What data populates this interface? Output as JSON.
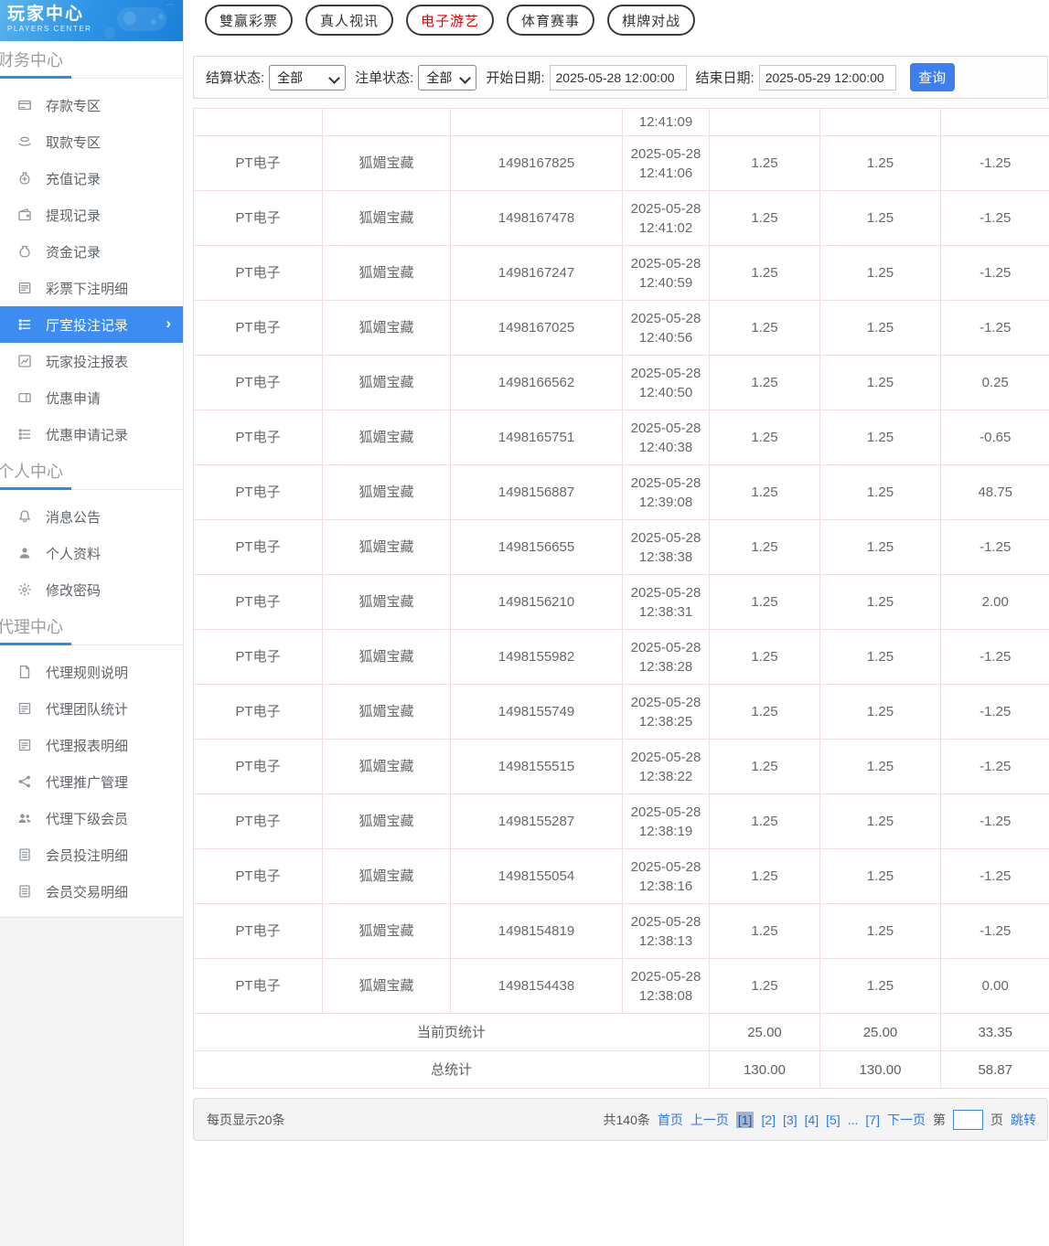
{
  "logo": {
    "title": "玩家中心",
    "subtitle": "PLAYERS CENTER"
  },
  "top_tabs": [
    {
      "label": "雙赢彩票",
      "active": false
    },
    {
      "label": "真人视讯",
      "active": false
    },
    {
      "label": "电子游艺",
      "active": true
    },
    {
      "label": "体育赛事",
      "active": false
    },
    {
      "label": "棋牌对战",
      "active": false
    }
  ],
  "sidebar": {
    "sections": [
      {
        "title": "财务中心",
        "items": [
          {
            "label": "存款专区",
            "icon": "deposit-card-icon",
            "active": false
          },
          {
            "label": "取款专区",
            "icon": "withdraw-hand-icon",
            "active": false
          },
          {
            "label": "充值记录",
            "icon": "recharge-record-icon",
            "active": false
          },
          {
            "label": "提现记录",
            "icon": "withdraw-record-icon",
            "active": false
          },
          {
            "label": "资金记录",
            "icon": "funds-record-icon",
            "active": false
          },
          {
            "label": "彩票下注明细",
            "icon": "lottery-bet-detail-icon",
            "active": false
          },
          {
            "label": "厅室投注记录",
            "icon": "hall-bet-record-icon",
            "active": true
          },
          {
            "label": "玩家投注报表",
            "icon": "player-bet-report-icon",
            "active": false
          },
          {
            "label": "优惠申请",
            "icon": "promo-apply-icon",
            "active": false
          },
          {
            "label": "优惠申请记录",
            "icon": "promo-record-icon",
            "active": false
          }
        ]
      },
      {
        "title": "个人中心",
        "items": [
          {
            "label": "消息公告",
            "icon": "bell-icon",
            "active": false
          },
          {
            "label": "个人资料",
            "icon": "user-icon",
            "active": false
          },
          {
            "label": "修改密码",
            "icon": "gear-icon",
            "active": false
          }
        ]
      },
      {
        "title": "代理中心",
        "items": [
          {
            "label": "代理规则说明",
            "icon": "doc-icon",
            "active": false
          },
          {
            "label": "代理团队统计",
            "icon": "report-icon",
            "active": false
          },
          {
            "label": "代理报表明细",
            "icon": "report-icon",
            "active": false
          },
          {
            "label": "代理推广管理",
            "icon": "share-icon",
            "active": false
          },
          {
            "label": "代理下级会员",
            "icon": "users-icon",
            "active": false
          },
          {
            "label": "会员投注明细",
            "icon": "doc-lines-icon",
            "active": false
          },
          {
            "label": "会员交易明细",
            "icon": "doc-lines-icon",
            "active": false
          }
        ]
      }
    ]
  },
  "filters": {
    "settle_status_label": "结算状态:",
    "settle_status_value": "全部",
    "order_status_label": "注单状态:",
    "order_status_value": "全部",
    "start_date_label": "开始日期:",
    "start_date_value": "2025-05-28 12:00:00",
    "end_date_label": "结束日期:",
    "end_date_value": "2025-05-29 12:00:00",
    "search_label": "查询"
  },
  "table": {
    "partial_row_time": "12:41:09",
    "rows": [
      {
        "game": "PT电子",
        "name": "狐媚宝藏",
        "order": "1498167825",
        "time": "2025-05-28 12:41:06",
        "bet": "1.25",
        "valid": "1.25",
        "winloss": "-1.25"
      },
      {
        "game": "PT电子",
        "name": "狐媚宝藏",
        "order": "1498167478",
        "time": "2025-05-28 12:41:02",
        "bet": "1.25",
        "valid": "1.25",
        "winloss": "-1.25"
      },
      {
        "game": "PT电子",
        "name": "狐媚宝藏",
        "order": "1498167247",
        "time": "2025-05-28 12:40:59",
        "bet": "1.25",
        "valid": "1.25",
        "winloss": "-1.25"
      },
      {
        "game": "PT电子",
        "name": "狐媚宝藏",
        "order": "1498167025",
        "time": "2025-05-28 12:40:56",
        "bet": "1.25",
        "valid": "1.25",
        "winloss": "-1.25"
      },
      {
        "game": "PT电子",
        "name": "狐媚宝藏",
        "order": "1498166562",
        "time": "2025-05-28 12:40:50",
        "bet": "1.25",
        "valid": "1.25",
        "winloss": "0.25"
      },
      {
        "game": "PT电子",
        "name": "狐媚宝藏",
        "order": "1498165751",
        "time": "2025-05-28 12:40:38",
        "bet": "1.25",
        "valid": "1.25",
        "winloss": "-0.65"
      },
      {
        "game": "PT电子",
        "name": "狐媚宝藏",
        "order": "1498156887",
        "time": "2025-05-28 12:39:08",
        "bet": "1.25",
        "valid": "1.25",
        "winloss": "48.75"
      },
      {
        "game": "PT电子",
        "name": "狐媚宝藏",
        "order": "1498156655",
        "time": "2025-05-28 12:38:38",
        "bet": "1.25",
        "valid": "1.25",
        "winloss": "-1.25"
      },
      {
        "game": "PT电子",
        "name": "狐媚宝藏",
        "order": "1498156210",
        "time": "2025-05-28 12:38:31",
        "bet": "1.25",
        "valid": "1.25",
        "winloss": "2.00"
      },
      {
        "game": "PT电子",
        "name": "狐媚宝藏",
        "order": "1498155982",
        "time": "2025-05-28 12:38:28",
        "bet": "1.25",
        "valid": "1.25",
        "winloss": "-1.25"
      },
      {
        "game": "PT电子",
        "name": "狐媚宝藏",
        "order": "1498155749",
        "time": "2025-05-28 12:38:25",
        "bet": "1.25",
        "valid": "1.25",
        "winloss": "-1.25"
      },
      {
        "game": "PT电子",
        "name": "狐媚宝藏",
        "order": "1498155515",
        "time": "2025-05-28 12:38:22",
        "bet": "1.25",
        "valid": "1.25",
        "winloss": "-1.25"
      },
      {
        "game": "PT电子",
        "name": "狐媚宝藏",
        "order": "1498155287",
        "time": "2025-05-28 12:38:19",
        "bet": "1.25",
        "valid": "1.25",
        "winloss": "-1.25"
      },
      {
        "game": "PT电子",
        "name": "狐媚宝藏",
        "order": "1498155054",
        "time": "2025-05-28 12:38:16",
        "bet": "1.25",
        "valid": "1.25",
        "winloss": "-1.25"
      },
      {
        "game": "PT电子",
        "name": "狐媚宝藏",
        "order": "1498154819",
        "time": "2025-05-28 12:38:13",
        "bet": "1.25",
        "valid": "1.25",
        "winloss": "-1.25"
      },
      {
        "game": "PT电子",
        "name": "狐媚宝藏",
        "order": "1498154438",
        "time": "2025-05-28 12:38:08",
        "bet": "1.25",
        "valid": "1.25",
        "winloss": "0.00"
      }
    ],
    "page_summary": {
      "label": "当前页统计",
      "bet": "25.00",
      "valid": "25.00",
      "winloss": "33.35"
    },
    "total_summary": {
      "label": "总统计",
      "bet": "130.00",
      "valid": "130.00",
      "winloss": "58.87"
    }
  },
  "pagination": {
    "per_page": "每页显示20条",
    "total": "共140条",
    "first": "首页",
    "prev": "上一页",
    "pages": [
      {
        "label": "[1]",
        "active": true
      },
      {
        "label": "[2]",
        "active": false
      },
      {
        "label": "[3]",
        "active": false
      },
      {
        "label": "[4]",
        "active": false
      },
      {
        "label": "[5]",
        "active": false
      },
      {
        "label": "...",
        "active": false
      },
      {
        "label": "[7]",
        "active": false
      }
    ],
    "next": "下一页",
    "jump_prefix": "第",
    "jump_suffix": "页",
    "jump_action": "跳转"
  },
  "colors": {
    "accent_blue": "#3d8cf2",
    "active_tab_red": "#e60000",
    "table_border": "#f3dede",
    "link_blue": "#2a7ae4",
    "pager_bg": "#f4f4f4"
  }
}
